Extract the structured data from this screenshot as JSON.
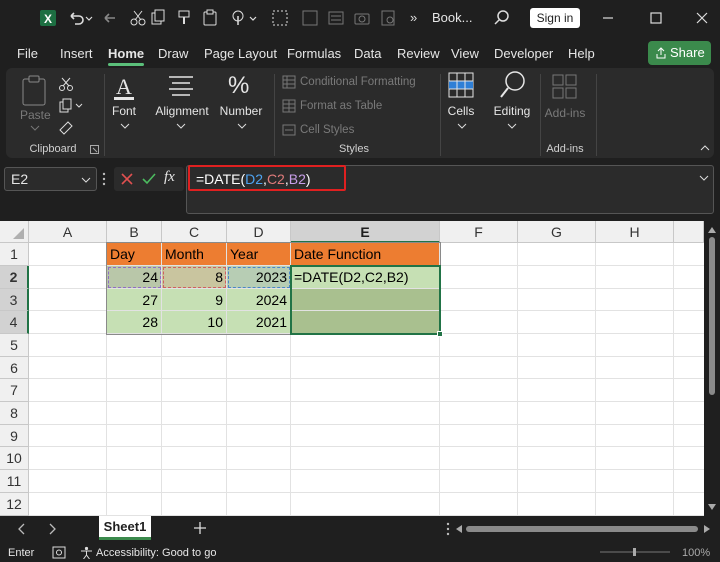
{
  "titlebar": {
    "doc_title": "Book...",
    "more": "»",
    "signin_label": "Sign in"
  },
  "tabs": [
    "File",
    "Insert",
    "Home",
    "Draw",
    "Page Layout",
    "Formulas",
    "Data",
    "Review",
    "View",
    "Developer",
    "Help"
  ],
  "share_label": "Share",
  "ribbon": {
    "paste": "Paste",
    "clipboard": "Clipboard",
    "font": "Font",
    "alignment": "Alignment",
    "number": "Number",
    "conditional_formatting": "Conditional Formatting",
    "format_as_table": "Format as Table",
    "cell_styles": "Cell Styles",
    "styles": "Styles",
    "cells": "Cells",
    "editing": "Editing",
    "addins": "Add-ins",
    "addins_group": "Add-ins"
  },
  "formula_bar": {
    "name_box": "E2",
    "fx": "fx",
    "formula_prefix": "=DATE(",
    "ref1": "D2",
    "comma1": ",",
    "ref2": "C2",
    "comma2": ",",
    "ref3": "B2",
    "suffix": ")"
  },
  "grid": {
    "columns": [
      "A",
      "B",
      "C",
      "D",
      "E",
      "F",
      "G",
      "H"
    ],
    "rows": [
      "1",
      "2",
      "3",
      "4",
      "5",
      "6",
      "7",
      "8",
      "9",
      "10",
      "11",
      "12"
    ],
    "headers": [
      "Day",
      "Month",
      "Year",
      "Date Function"
    ],
    "data": [
      [
        "24",
        "8",
        "2023",
        "=DATE(D2,C2,B2)"
      ],
      [
        "27",
        "9",
        "2024",
        ""
      ],
      [
        "28",
        "10",
        "2021",
        ""
      ]
    ]
  },
  "sheet_tab": "Sheet1",
  "status": {
    "mode": "Enter",
    "accessibility": "Accessibility: Good to go",
    "zoom": "100%"
  },
  "colors": {
    "header_orange": "#ed7d31",
    "data_green": "#c6e0b4",
    "selected_green": "#a9c08f",
    "accent_green": "#3b8a4c",
    "highlight_red": "#e02020"
  }
}
